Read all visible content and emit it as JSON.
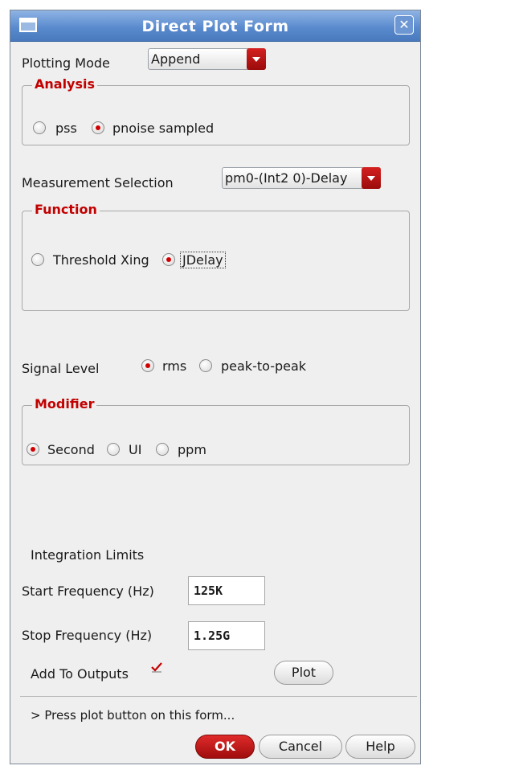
{
  "window": {
    "title": "Direct Plot Form"
  },
  "plotting_mode": {
    "label": "Plotting Mode",
    "value": "Append"
  },
  "analysis": {
    "title": "Analysis",
    "options": [
      {
        "label": "pss",
        "selected": false
      },
      {
        "label": "pnoise sampled",
        "selected": true
      }
    ]
  },
  "measurement": {
    "label": "Measurement Selection",
    "value": "pm0-(Int2 0)-Delay"
  },
  "function": {
    "title": "Function",
    "options": [
      {
        "label": "Threshold Xing",
        "selected": false
      },
      {
        "label": "JDelay",
        "selected": true
      }
    ]
  },
  "signal_level": {
    "label": "Signal Level",
    "options": [
      {
        "label": "rms",
        "selected": true
      },
      {
        "label": "peak-to-peak",
        "selected": false
      }
    ]
  },
  "modifier": {
    "title": "Modifier",
    "options": [
      {
        "label": "Second",
        "selected": true
      },
      {
        "label": "UI",
        "selected": false
      },
      {
        "label": "ppm",
        "selected": false
      }
    ]
  },
  "integration": {
    "label": "Integration Limits",
    "start_label": "Start Frequency (Hz)",
    "start_value": "125K",
    "stop_label": "Stop Frequency (Hz)",
    "stop_value": "1.25G"
  },
  "add_to_outputs": {
    "label": "Add To Outputs",
    "checked": true
  },
  "buttons": {
    "plot": "Plot",
    "ok": "OK",
    "cancel": "Cancel",
    "help": "Help"
  },
  "status": "> Press plot button on this form...",
  "colors": {
    "accent": "#c20000",
    "titlebar": "#5b8bcf",
    "background": "#efefef"
  },
  "icons": {
    "close": "close-icon",
    "window": "window-icon",
    "dropdown": "chevron-down-icon",
    "check": "checkmark-icon"
  }
}
